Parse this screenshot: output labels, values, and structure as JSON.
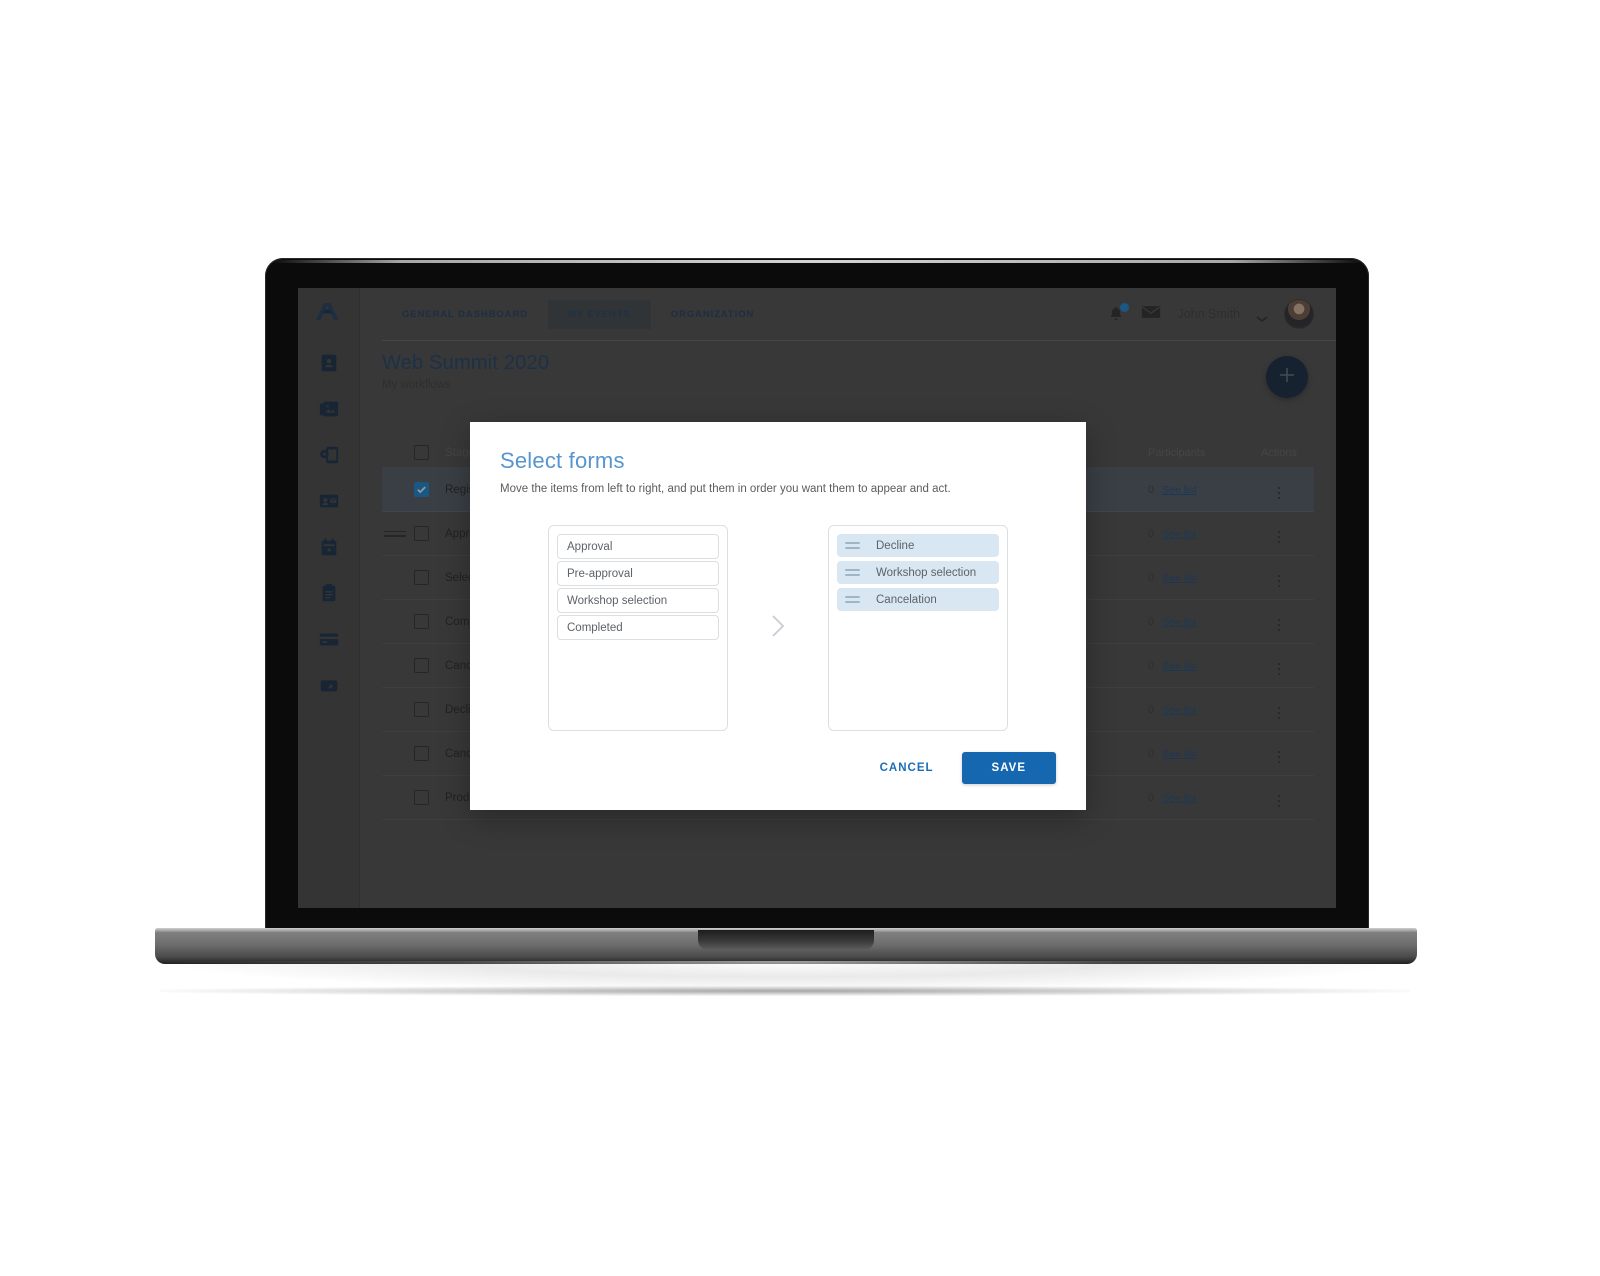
{
  "colors": {
    "accent": "#1568b0",
    "modal_title": "#5795cf",
    "dst_item_bg": "#d8e7f2",
    "screen_bg": "#4b4b4b",
    "brand_dark": "#14273c"
  },
  "brand": {
    "logo_icon": "logo-a-icon"
  },
  "topnav": {
    "tabs": [
      {
        "label": "GENERAL DASHBOARD",
        "active": false
      },
      {
        "label": "MY EVENTS",
        "active": true
      },
      {
        "label": "ORGANIZATION",
        "active": false
      }
    ],
    "notifications_icon": "bell-icon",
    "messages_icon": "envelope-icon",
    "user_name": "John Smith",
    "caret_icon": "chevron-down-icon",
    "avatar_icon": "avatar"
  },
  "page": {
    "title": "Web Summit 2020",
    "subtitle": "My workflows",
    "fab_icon": "plus-icon"
  },
  "sidebar": {
    "items": [
      {
        "icon": "id-badge-icon"
      },
      {
        "icon": "photos-icon"
      },
      {
        "icon": "device-settings-icon"
      },
      {
        "icon": "contact-card-icon"
      },
      {
        "icon": "calendar-icon"
      },
      {
        "icon": "clipboard-icon"
      },
      {
        "icon": "credit-card-icon"
      },
      {
        "icon": "share-export-icon"
      }
    ]
  },
  "table": {
    "columns": {
      "stage": "Stage",
      "participants": "Participants",
      "actions": "Actions"
    },
    "see_list_label": "See list",
    "rows": [
      {
        "stage": "Registered",
        "participants": "0",
        "selected": true,
        "draggable": false
      },
      {
        "stage": "Approve",
        "participants": "0",
        "selected": false,
        "draggable": true
      },
      {
        "stage": "Select ac",
        "participants": "0",
        "selected": false,
        "draggable": false
      },
      {
        "stage": "Completed",
        "participants": "0",
        "selected": false,
        "draggable": false
      },
      {
        "stage": "Cancel s",
        "participants": "0",
        "selected": false,
        "draggable": false
      },
      {
        "stage": "Decline",
        "participants": "0",
        "selected": false,
        "draggable": false
      },
      {
        "stage": "Canceled",
        "participants": "0",
        "selected": false,
        "draggable": false
      },
      {
        "stage": "Product",
        "participants": "0",
        "selected": false,
        "draggable": false
      }
    ]
  },
  "modal": {
    "title": "Select forms",
    "description": "Move the items from left to right, and put them in order you want them to appear and act.",
    "arrow_icon": "chevron-right-icon",
    "available": [
      {
        "label": "Approval"
      },
      {
        "label": "Pre-approval"
      },
      {
        "label": "Workshop selection"
      },
      {
        "label": "Completed"
      }
    ],
    "selected": [
      {
        "label": "Decline",
        "handle_icon": "drag-handle-icon"
      },
      {
        "label": "Workshop selection",
        "handle_icon": "drag-handle-icon"
      },
      {
        "label": "Cancelation",
        "handle_icon": "drag-handle-icon"
      }
    ],
    "cancel_label": "CANCEL",
    "save_label": "SAVE"
  }
}
